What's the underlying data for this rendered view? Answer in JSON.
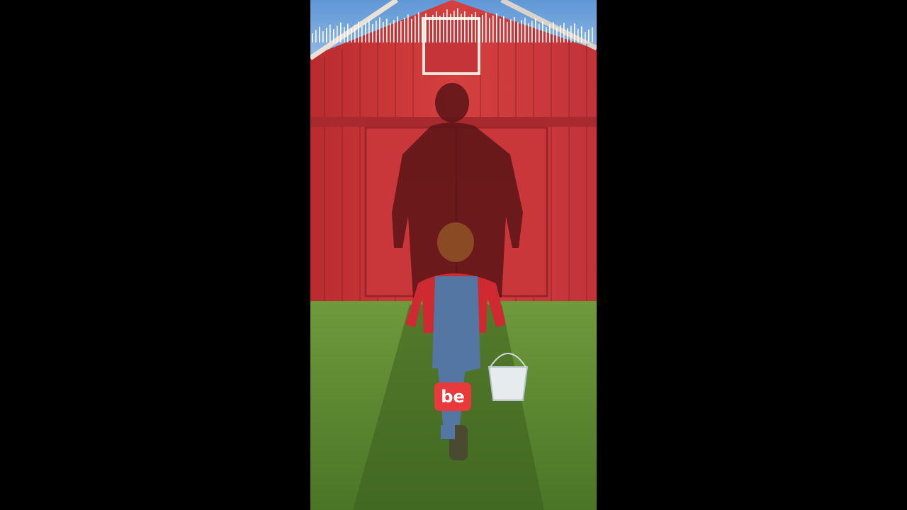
{
  "caption": {
    "word": "be",
    "background": "#e8393d",
    "text_color": "#ffffff"
  },
  "scene": {
    "sky": "#6fa0d8",
    "barn": "#c8363a",
    "grass": "#5f8a32",
    "shadow": "#5a1416"
  },
  "audio_waveform": {
    "color": "#ffffff"
  }
}
